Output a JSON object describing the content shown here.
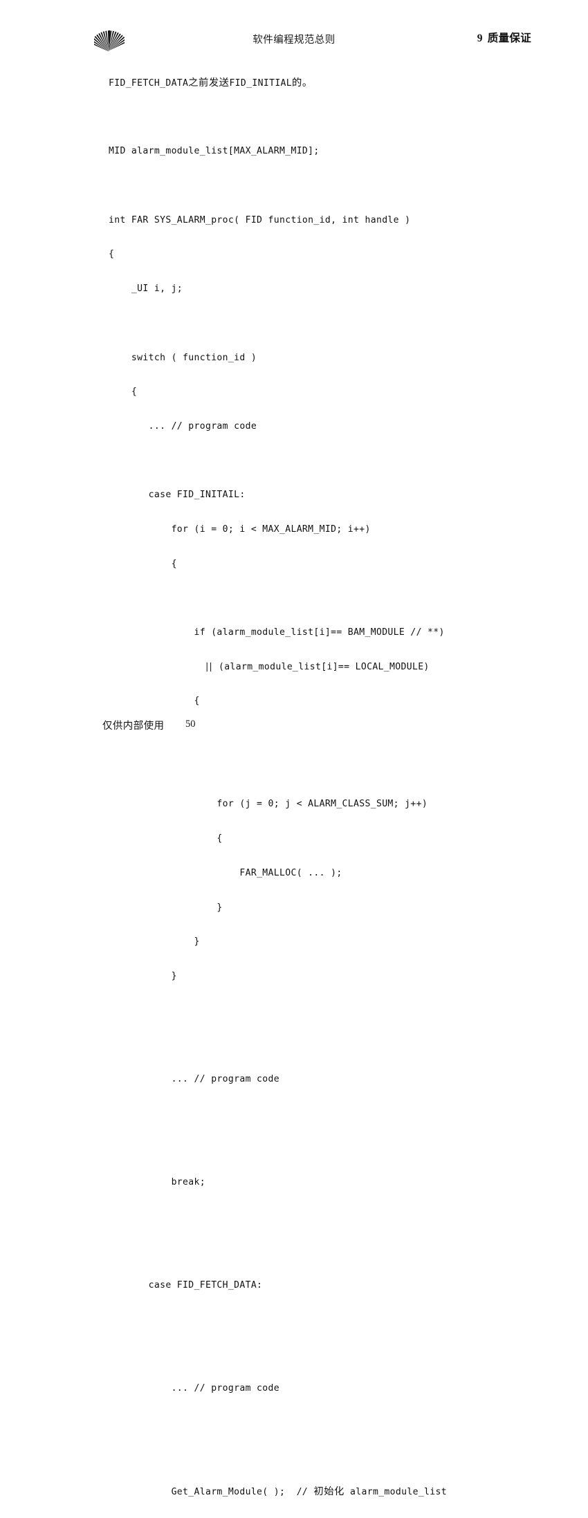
{
  "document": {
    "header": {
      "logo_icon": "fan-shell-logo-icon",
      "center_title": "软件编程规范总则",
      "chapter_number": "9",
      "chapter_title": "质量保证"
    },
    "footer": {
      "note": "仅供内部使用",
      "page_number": "50"
    },
    "code_lines": [
      {
        "indent": 0,
        "segments": [
          {
            "type": "mono",
            "text": "FID_FETCH_DATA"
          },
          {
            "type": "cjk",
            "text": "之前发送"
          },
          {
            "type": "mono",
            "text": "FID_INITIAL"
          },
          {
            "type": "cjk",
            "text": "的。"
          }
        ]
      },
      {
        "indent": 0,
        "segments": []
      },
      {
        "indent": 0,
        "segments": [
          {
            "type": "mono",
            "text": "MID alarm_module_list[MAX_ALARM_MID];"
          }
        ]
      },
      {
        "indent": 0,
        "segments": []
      },
      {
        "indent": 0,
        "segments": [
          {
            "type": "mono",
            "text": "int FAR SYS_ALARM_proc( FID function_id, int handle )"
          }
        ]
      },
      {
        "indent": 0,
        "segments": [
          {
            "type": "mono",
            "text": "{"
          }
        ]
      },
      {
        "indent": 0,
        "segments": [
          {
            "type": "mono",
            "text": "    _UI i, j;"
          }
        ]
      },
      {
        "indent": 0,
        "segments": []
      },
      {
        "indent": 0,
        "segments": [
          {
            "type": "mono",
            "text": "    switch ( function_id )"
          }
        ]
      },
      {
        "indent": 0,
        "segments": [
          {
            "type": "mono",
            "text": "    {"
          }
        ]
      },
      {
        "indent": 0,
        "segments": [
          {
            "type": "mono",
            "text": "       ... // program code"
          }
        ]
      },
      {
        "indent": 0,
        "segments": []
      },
      {
        "indent": 0,
        "segments": [
          {
            "type": "mono",
            "text": "       case FID_INITAIL:"
          }
        ]
      },
      {
        "indent": 0,
        "segments": [
          {
            "type": "mono",
            "text": "           for (i = 0; i < MAX_ALARM_MID; i++)"
          }
        ]
      },
      {
        "indent": 0,
        "segments": [
          {
            "type": "mono",
            "text": "           {"
          }
        ]
      },
      {
        "indent": 0,
        "segments": []
      },
      {
        "indent": 0,
        "segments": [
          {
            "type": "mono",
            "text": "               if (alarm_module_list[i]== BAM_MODULE // **)"
          }
        ]
      },
      {
        "indent": 0,
        "segments": [
          {
            "type": "mono",
            "text": "                 "
          },
          {
            "type": "pipe",
            "text": "||"
          },
          {
            "type": "mono",
            "text": " (alarm_module_list[i]== LOCAL_MODULE)"
          }
        ]
      },
      {
        "indent": 0,
        "segments": [
          {
            "type": "mono",
            "text": "               {"
          }
        ]
      },
      {
        "indent": 0,
        "segments": []
      },
      {
        "indent": 0,
        "segments": []
      },
      {
        "indent": 0,
        "segments": [
          {
            "type": "mono",
            "text": "                   for (j = 0; j < ALARM_CLASS_SUM; j++)"
          }
        ]
      },
      {
        "indent": 0,
        "segments": [
          {
            "type": "mono",
            "text": "                   {"
          }
        ]
      },
      {
        "indent": 0,
        "segments": [
          {
            "type": "mono",
            "text": "                       FAR_MALLOC( ... );"
          }
        ]
      },
      {
        "indent": 0,
        "segments": [
          {
            "type": "mono",
            "text": "                   }"
          }
        ]
      },
      {
        "indent": 0,
        "segments": [
          {
            "type": "mono",
            "text": "               }"
          }
        ]
      },
      {
        "indent": 0,
        "segments": [
          {
            "type": "mono",
            "text": "           }"
          }
        ]
      },
      {
        "indent": 0,
        "segments": []
      },
      {
        "indent": 0,
        "segments": []
      },
      {
        "indent": 0,
        "segments": [
          {
            "type": "mono",
            "text": "           ... // program code"
          }
        ]
      },
      {
        "indent": 0,
        "segments": []
      },
      {
        "indent": 0,
        "segments": []
      },
      {
        "indent": 0,
        "segments": [
          {
            "type": "mono",
            "text": "           break;"
          }
        ]
      },
      {
        "indent": 0,
        "segments": []
      },
      {
        "indent": 0,
        "segments": []
      },
      {
        "indent": 0,
        "segments": [
          {
            "type": "mono",
            "text": "       case FID_FETCH_DATA:"
          }
        ]
      },
      {
        "indent": 0,
        "segments": []
      },
      {
        "indent": 0,
        "segments": []
      },
      {
        "indent": 0,
        "segments": [
          {
            "type": "mono",
            "text": "           ... // program code"
          }
        ]
      },
      {
        "indent": 0,
        "segments": []
      },
      {
        "indent": 0,
        "segments": []
      },
      {
        "indent": 0,
        "segments": [
          {
            "type": "mono",
            "text": "           Get_Alarm_Module( );  // "
          },
          {
            "type": "cjk",
            "text": "初始化"
          },
          {
            "type": "mono",
            "text": " alarm_module_list"
          }
        ]
      }
    ]
  }
}
